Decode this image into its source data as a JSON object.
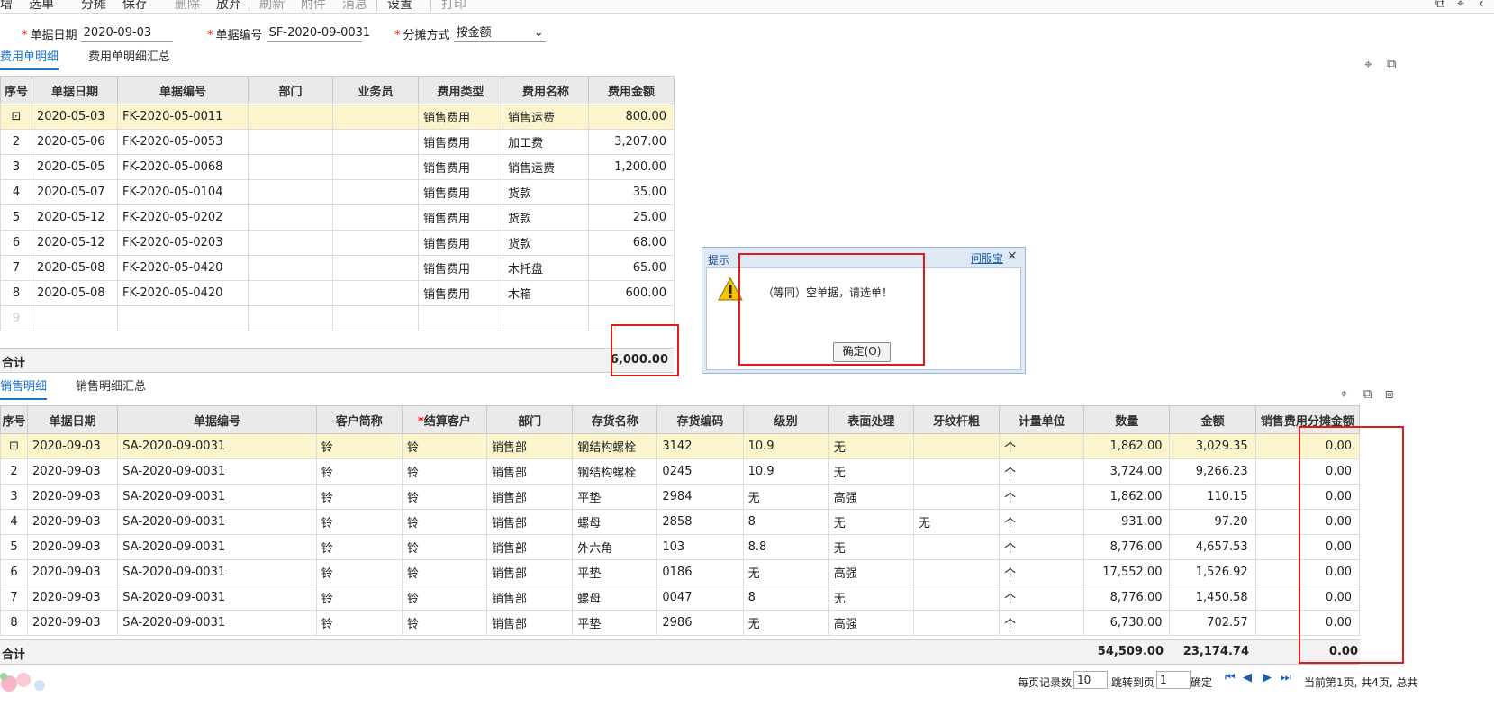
{
  "toolbar": {
    "items": [
      "增",
      "选单",
      "分摊",
      "保存",
      "删除",
      "放弃",
      "刷新",
      "附件",
      "消息",
      "设置",
      "打印"
    ]
  },
  "form": {
    "date_label": "单据日期",
    "date_value": "2020-09-03",
    "no_label": "单据编号",
    "no_value": "SF-2020-09-0031",
    "method_label": "分摊方式",
    "method_value": "按金额"
  },
  "tabs_top": [
    "费用单明细",
    "费用单明细汇总"
  ],
  "expense_table": {
    "columns": [
      "序号",
      "单据日期",
      "单据编号",
      "部门",
      "业务员",
      "费用类型",
      "费用名称",
      "费用金额"
    ],
    "rows": [
      [
        "",
        "2020-05-03",
        "FK-2020-05-0011",
        "",
        "",
        "销售费用",
        "销售运费",
        "800.00"
      ],
      [
        "2",
        "2020-05-06",
        "FK-2020-05-0053",
        "",
        "",
        "销售费用",
        "加工费",
        "3,207.00"
      ],
      [
        "3",
        "2020-05-05",
        "FK-2020-05-0068",
        "",
        "",
        "销售费用",
        "销售运费",
        "1,200.00"
      ],
      [
        "4",
        "2020-05-07",
        "FK-2020-05-0104",
        "",
        "",
        "销售费用",
        "货款",
        "35.00"
      ],
      [
        "5",
        "2020-05-12",
        "FK-2020-05-0202",
        "",
        "",
        "销售费用",
        "货款",
        "25.00"
      ],
      [
        "6",
        "2020-05-12",
        "FK-2020-05-0203",
        "",
        "",
        "销售费用",
        "货款",
        "68.00"
      ],
      [
        "7",
        "2020-05-08",
        "FK-2020-05-0420",
        "",
        "",
        "销售费用",
        "木托盘",
        "65.00"
      ],
      [
        "8",
        "2020-05-08",
        "FK-2020-05-0420",
        "",
        "",
        "销售费用",
        "木箱",
        "600.00"
      ],
      [
        "9",
        "",
        "",
        "",
        "",
        "",
        "",
        ""
      ]
    ],
    "total_label": "合计",
    "total_value": "6,000.00"
  },
  "tabs_bottom": [
    "销售明细",
    "销售明细汇总"
  ],
  "sales_table": {
    "columns": [
      "序号",
      "单据日期",
      "单据编号",
      "客户简称",
      "结算客户",
      "部门",
      "存货名称",
      "存货编码",
      "级别",
      "表面处理",
      "牙纹杆粗",
      "计量单位",
      "数量",
      "金额",
      "销售费用分摊金额"
    ],
    "rows": [
      [
        "",
        "2020-09-03",
        "SA-2020-09-0031",
        "铃",
        "铃",
        "销售部",
        "钢结构螺栓",
        "3142",
        "10.9",
        "无",
        "",
        "个",
        "1,862.00",
        "3,029.35",
        "0.00"
      ],
      [
        "2",
        "2020-09-03",
        "SA-2020-09-0031",
        "铃",
        "铃",
        "销售部",
        "钢结构螺栓",
        "0245",
        "10.9",
        "无",
        "",
        "个",
        "3,724.00",
        "9,266.23",
        "0.00"
      ],
      [
        "3",
        "2020-09-03",
        "SA-2020-09-0031",
        "铃",
        "铃",
        "销售部",
        "平垫",
        "2984",
        "无",
        "高强",
        "",
        "个",
        "1,862.00",
        "110.15",
        "0.00"
      ],
      [
        "4",
        "2020-09-03",
        "SA-2020-09-0031",
        "铃",
        "铃",
        "销售部",
        "螺母",
        "2858",
        "8",
        "无",
        "无",
        "个",
        "931.00",
        "97.20",
        "0.00"
      ],
      [
        "5",
        "2020-09-03",
        "SA-2020-09-0031",
        "铃",
        "铃",
        "销售部",
        "外六角",
        "103",
        "8.8",
        "无",
        "",
        "个",
        "8,776.00",
        "4,657.53",
        "0.00"
      ],
      [
        "6",
        "2020-09-03",
        "SA-2020-09-0031",
        "铃",
        "铃",
        "销售部",
        "平垫",
        "0186",
        "无",
        "高强",
        "",
        "个",
        "17,552.00",
        "1,526.92",
        "0.00"
      ],
      [
        "7",
        "2020-09-03",
        "SA-2020-09-0031",
        "铃",
        "铃",
        "销售部",
        "螺母",
        "0047",
        "8",
        "无",
        "",
        "个",
        "8,776.00",
        "1,450.58",
        "0.00"
      ],
      [
        "8",
        "2020-09-03",
        "SA-2020-09-0031",
        "铃",
        "铃",
        "销售部",
        "平垫",
        "2986",
        "无",
        "高强",
        "",
        "个",
        "6,730.00",
        "702.57",
        "0.00"
      ]
    ],
    "total_label": "合计",
    "total_qty": "54,509.00",
    "total_amount": "23,174.74",
    "total_alloc": "0.00"
  },
  "dialog": {
    "title": "提示",
    "link": "问服宝",
    "close": "×",
    "message": "（等同）空单据，请选单！",
    "ok_button": "确定(O)"
  },
  "pager": {
    "per_page_label": "每页记录数",
    "per_page_value": "10",
    "jump_label": "跳转到页",
    "jump_value": "1",
    "confirm": "确定",
    "status": "当前第1页, 共4页, 总共"
  },
  "colors": {
    "accent": "#1a73c8",
    "highlight": "#fcf4cc",
    "annotation": "#e01b1b"
  }
}
